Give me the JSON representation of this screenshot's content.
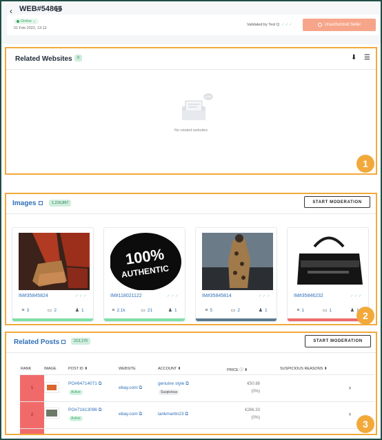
{
  "header": {
    "back_icon": "arrow-left-icon",
    "web_id": "WEB#54866",
    "status": "Online",
    "date": "01 Feb 2022, 13:12",
    "validated_by": "Validated by Test Q",
    "validated_checks": "✓✓✓",
    "unauthorized_button": "Unauthorized Seller"
  },
  "related_websites": {
    "title": "Related Websites",
    "count": "0",
    "empty_text": "No related websites",
    "badge_number": "1"
  },
  "images": {
    "title": "Images",
    "count": "1,216,867",
    "start_button": "START MODERATION",
    "badge_number": "2",
    "cards": [
      {
        "id": "IM#35845824",
        "checks": "✓✓✓",
        "stat1": "3",
        "stat2": "2",
        "stat3": "1",
        "bar_color": "#7ee0a6"
      },
      {
        "id": "IM#118021122",
        "checks": "✓✓✓",
        "stat1": "2.1k",
        "stat2": "21",
        "stat3": "1",
        "bar_color": "#7ee0a6"
      },
      {
        "id": "IM#35845814",
        "checks": "✓✓✓",
        "stat1": "5",
        "stat2": "2",
        "stat3": "1",
        "bar_color": "#5b7a8e"
      },
      {
        "id": "IM#35846232",
        "checks": "✓✓✓",
        "stat1": "1",
        "stat2": "1",
        "stat3": "1",
        "bar_color": "#f16a6a"
      }
    ],
    "authentic_line1": "100%",
    "authentic_line2": "AUTHENTIC"
  },
  "related_posts": {
    "title": "Related Posts",
    "count": "213,170",
    "start_button": "START MODERATION",
    "badge_number": "3",
    "columns": {
      "rank": "RANK",
      "image": "IMAGE",
      "post_id": "POST ID",
      "website": "WEBSITE",
      "account": "ACCOUNT",
      "price": "PRICE",
      "reasons": "SUSPICIOUS REASONS"
    },
    "rows": [
      {
        "rank": "1",
        "post_id": "PO#64714071",
        "status": "Active",
        "website": "ebay.com",
        "account": "genuine style",
        "account_tag": "Suspicious",
        "price": "€50.88",
        "price_pct": "(0%)"
      },
      {
        "rank": "2",
        "post_id": "PO#71613096",
        "status": "Active",
        "website": "ebay.com",
        "account": "tankmartin23",
        "account_tag": "",
        "price": "€266.33",
        "price_pct": "(0%)"
      }
    ]
  },
  "colors": {
    "highlight": "#f2a93b",
    "brand_blue": "#2f6fb7",
    "unauthorized": "#f7a58a",
    "rank_red": "#f16a6a"
  }
}
